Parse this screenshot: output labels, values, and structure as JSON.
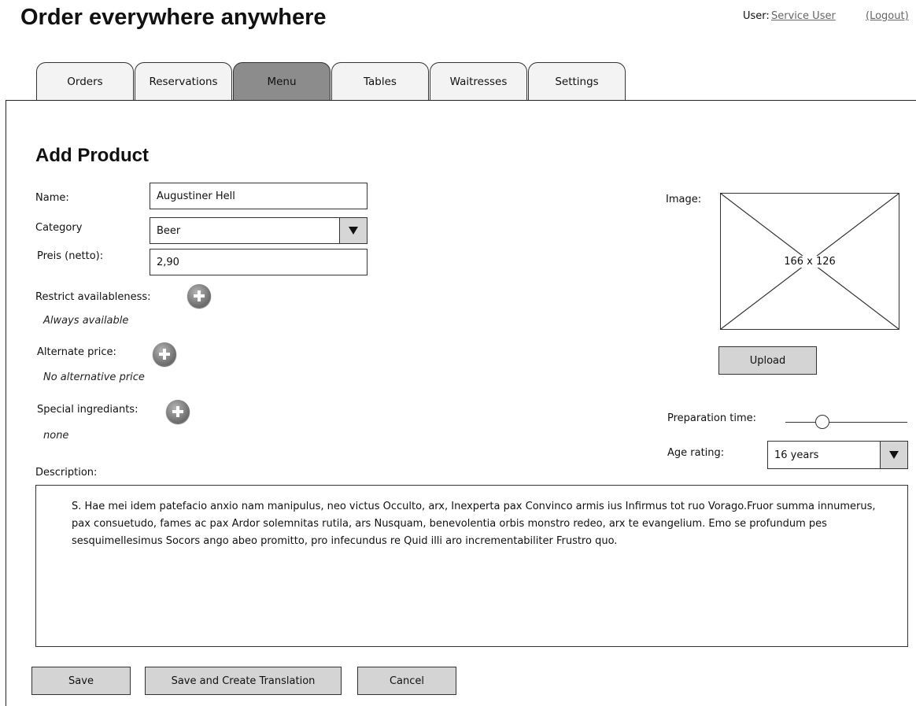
{
  "header": {
    "app_title": "Order everywhere anywhere",
    "user_label": "User:",
    "user_name": "Service User",
    "logout_label": "(Logout)"
  },
  "tabs": [
    {
      "label": "Orders",
      "active": false
    },
    {
      "label": "Reservations",
      "active": false
    },
    {
      "label": "Menu",
      "active": true
    },
    {
      "label": "Tables",
      "active": false
    },
    {
      "label": "Waitresses",
      "active": false
    },
    {
      "label": "Settings",
      "active": false
    }
  ],
  "form": {
    "title": "Add Product",
    "name": {
      "label": "Name:",
      "value": "Augustiner Hell"
    },
    "category": {
      "label": "Category",
      "value": "Beer"
    },
    "price": {
      "label": "Preis (netto):",
      "value": "2,90"
    },
    "restrict": {
      "label": "Restrict availableness:",
      "value": "Always available"
    },
    "alternate_price": {
      "label": "Alternate price:",
      "value": "No alternative price"
    },
    "special_ingredients": {
      "label": "Special ingrediants:",
      "value": "none"
    },
    "description": {
      "label": "Description:",
      "value": "S. Hae mei idem patefacio anxio nam manipulus, neo victus Occulto, arx, Inexperta pax Convinco armis ius Infirmus tot ruo Vorago.Fruor summa innumerus, pax consuetudo, fames ac pax Ardor solemnitas rutila, ars Nusquam, benevolentia orbis monstro redeo, arx te evangelium. Emo se profundum pes sesquimellesimus Socors ango abeo promitto, pro infecundus re Quid illi aro incrementabiliter Frustro quo."
    }
  },
  "image": {
    "label": "Image:",
    "dimensions": "166 x 126",
    "upload_label": "Upload"
  },
  "preparation_time": {
    "label": "Preparation time:",
    "level": 0.28
  },
  "age_rating": {
    "label": "Age rating:",
    "value": "16 years"
  },
  "buttons": {
    "save": "Save",
    "save_translate": "Save and Create Translation",
    "cancel": "Cancel"
  },
  "icons": {
    "plus": "plus-circle-icon",
    "dropdown": "triangle-down-icon",
    "image_placeholder": "image-placeholder-icon"
  }
}
